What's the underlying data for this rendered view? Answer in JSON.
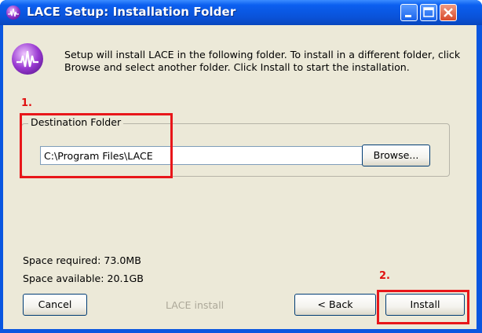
{
  "window": {
    "title": "LACE Setup: Installation Folder"
  },
  "intro_text": "Setup will install LACE in the following folder. To install in a different folder, click Browse and select another folder. Click Install to start the installation.",
  "annotations": {
    "step1": "1.",
    "step2": "2."
  },
  "destination": {
    "group_label": "Destination Folder",
    "value": "C:\\Program Files\\LACE",
    "browse_label": "Browse..."
  },
  "space": {
    "required": "Space required: 73.0MB",
    "available": "Space available: 20.1GB"
  },
  "footer": {
    "cancel_label": "Cancel",
    "branding": "LACE install",
    "back_label": "< Back",
    "install_label": "Install"
  },
  "colors": {
    "title_bar": "#0a56e0",
    "dialog_bg": "#ece9d8",
    "annotation": "#e8161a"
  },
  "icons": {
    "app": "lace-logo-icon",
    "minimize": "minimize-icon",
    "maximize": "maximize-icon",
    "close": "close-icon"
  }
}
